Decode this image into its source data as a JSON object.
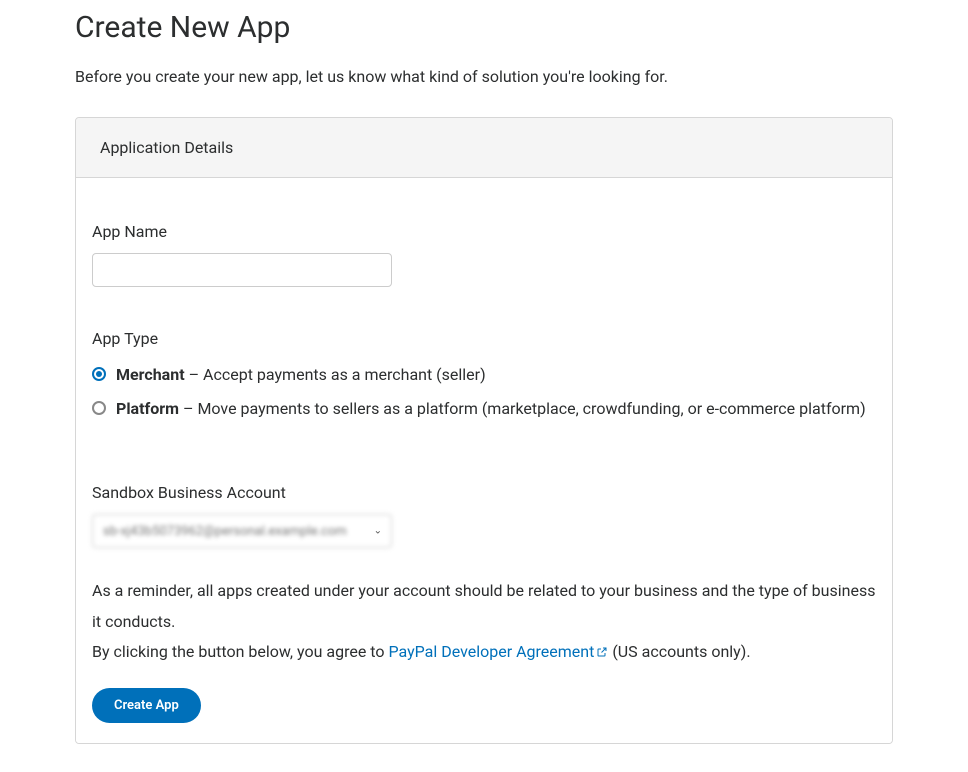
{
  "page": {
    "title": "Create New App",
    "subtitle": "Before you create your new app, let us know what kind of solution you're looking for."
  },
  "panel": {
    "header": "Application Details"
  },
  "form": {
    "app_name_label": "App Name",
    "app_name_value": "",
    "app_type_label": "App Type",
    "app_type_options": [
      {
        "name": "Merchant",
        "sep": " – ",
        "description": "Accept payments as a merchant (seller)",
        "selected": true
      },
      {
        "name": "Platform",
        "sep": " – ",
        "description": "Move payments to sellers as a platform (marketplace, crowdfunding, or e-commerce platform)",
        "selected": false
      }
    ],
    "sandbox_label": "Sandbox Business Account",
    "sandbox_value": "sb-xj43b5073962@personal.example.com",
    "reminder1": "As a reminder, all apps created under your account should be related to your business and the type of business it conducts.",
    "agree_prefix": "By clicking the button below, you agree to ",
    "agree_link": "PayPal Developer Agreement",
    "agree_suffix": " (US accounts only).",
    "submit_label": "Create App"
  }
}
